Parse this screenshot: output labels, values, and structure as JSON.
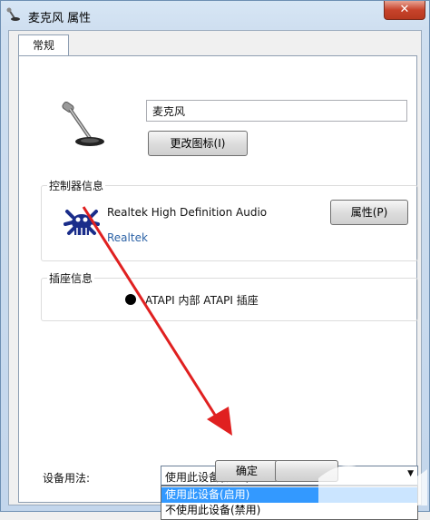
{
  "window": {
    "title": "麦克风 属性",
    "close_glyph": "✕"
  },
  "tabs": [
    {
      "label": "常规"
    }
  ],
  "device": {
    "name_value": "麦克风",
    "change_icon_label": "更改图标(I)"
  },
  "controller": {
    "group_label": "控制器信息",
    "device_name": "Realtek High Definition Audio",
    "vendor": "Realtek",
    "properties_label": "属性(P)"
  },
  "jack": {
    "group_label": "插座信息",
    "description": "ATAPI 内部 ATAPI 插座"
  },
  "usage": {
    "label": "设备用法:",
    "selected": "使用此设备(启用)",
    "options": [
      "使用此设备(启用)",
      "不使用此设备(禁用)"
    ]
  },
  "footer": {
    "ok_label": "确定"
  },
  "colors": {
    "highlight": "#3399ff",
    "arrow": "#e02020",
    "link": "#2d63a6"
  },
  "icons": {
    "title": "microphone-icon",
    "device": "microphone-icon",
    "controller": "realtek-crab-icon",
    "jack": "black-dot-icon"
  }
}
